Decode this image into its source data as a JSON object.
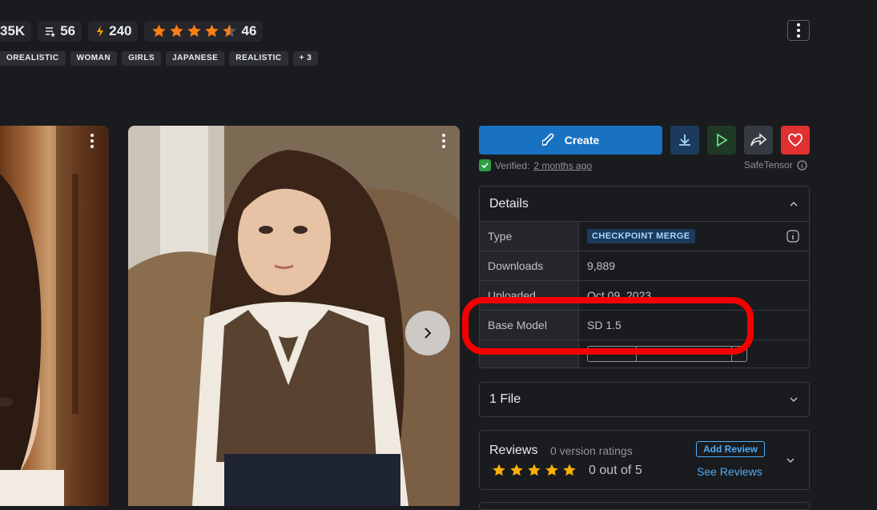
{
  "stats": {
    "downloads_partial": "35K",
    "collections": "56",
    "buzz": "240",
    "rating_count": "46"
  },
  "tags": [
    "OREALISTIC",
    "WOMAN",
    "GIRLS",
    "JAPANESE",
    "REALISTIC",
    "+ 3"
  ],
  "actions": {
    "create_label": "Create"
  },
  "verified": {
    "label": "Verified:",
    "time": "2 months ago",
    "format": "SafeTensor"
  },
  "details": {
    "title": "Details",
    "rows": [
      {
        "key": "Type",
        "value": "CHECKPOINT MERGE"
      },
      {
        "key": "Downloads",
        "value": "9,889"
      },
      {
        "key": "Uploaded",
        "value": "Oct 09, 2023"
      },
      {
        "key": "Base Model",
        "value": "SD 1.5"
      }
    ]
  },
  "files": {
    "label": "1 File"
  },
  "reviews": {
    "title": "Reviews",
    "ratings": "0 version ratings",
    "score": "0 out of 5",
    "add_review": "Add Review",
    "see_reviews": "See Reviews"
  },
  "colors": {
    "accent": "#1971c2",
    "star": "#fab005",
    "highlight": "#f50000",
    "like": "#e03131"
  }
}
